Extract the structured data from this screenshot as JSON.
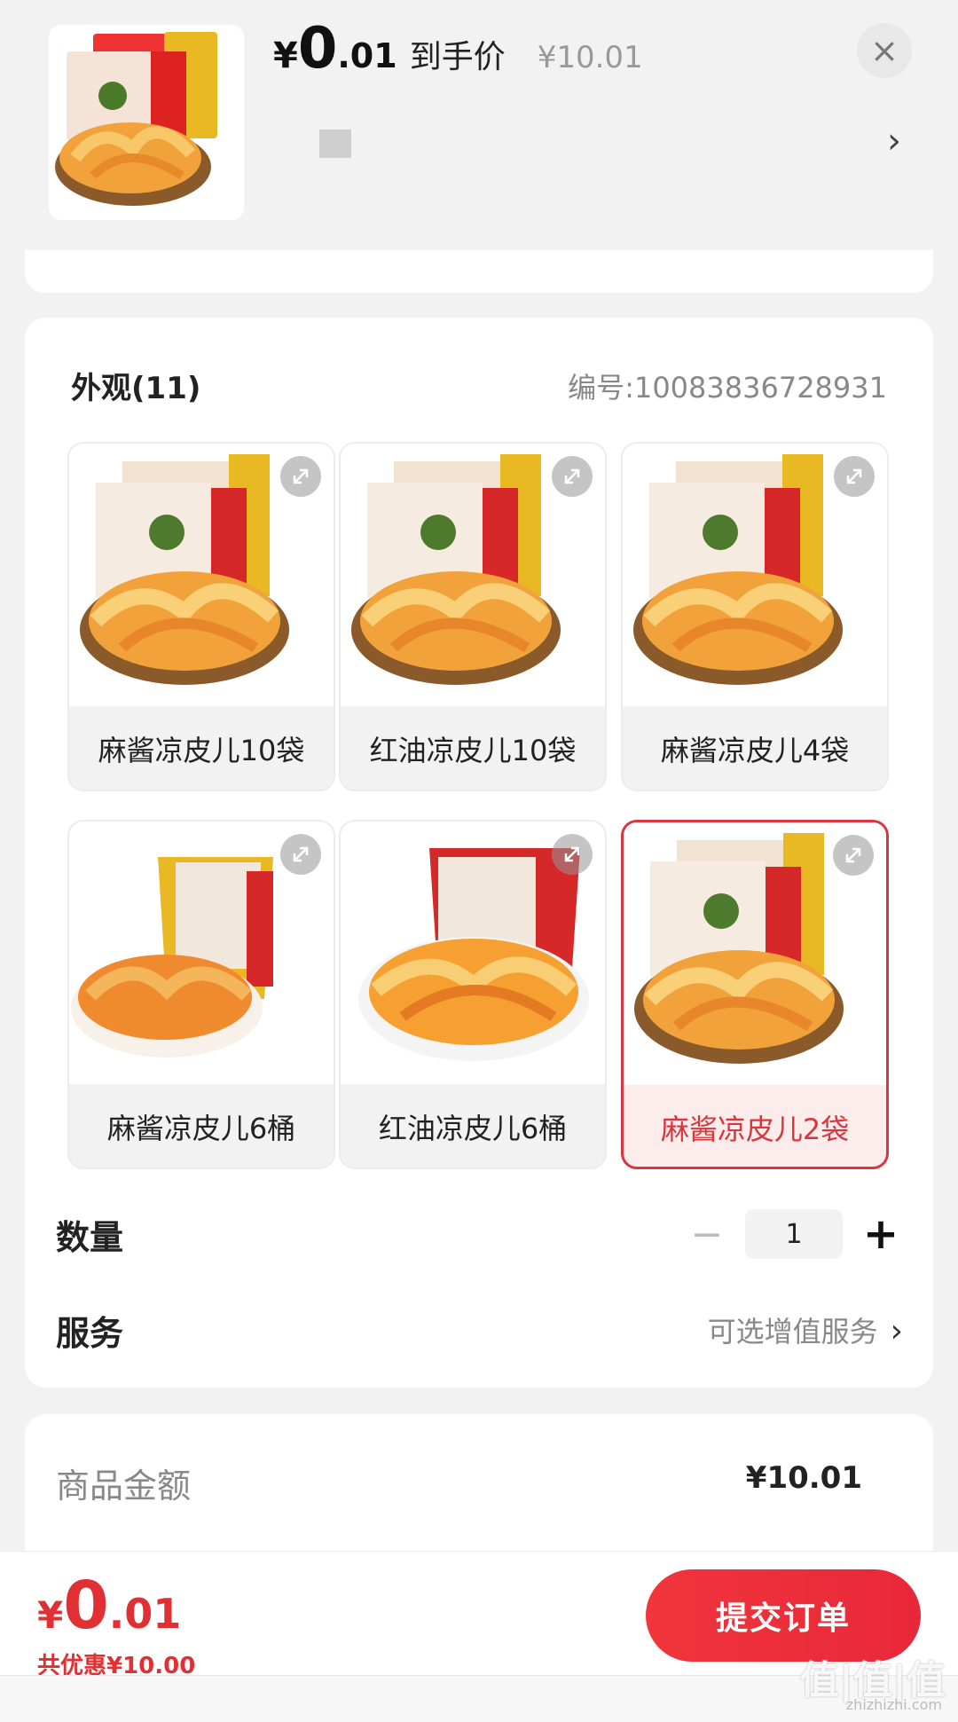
{
  "header": {
    "price_yen": "¥",
    "price_int": "0",
    "price_dec": ".01",
    "price_tag": "到手价",
    "original_price": "¥10.01",
    "close_icon": "×",
    "chevron": "›"
  },
  "appearance": {
    "title": "外观(11)",
    "code": "编号:10083836728931",
    "options": [
      {
        "label": "麻酱凉皮儿10袋",
        "image": "bag-pack",
        "selected": false
      },
      {
        "label": "红油凉皮儿10袋",
        "image": "bag-pack",
        "selected": false
      },
      {
        "label": "麻酱凉皮儿4袋",
        "image": "bag-pack",
        "selected": false
      },
      {
        "label": "麻酱凉皮儿6桶",
        "image": "bucket-pack",
        "selected": false
      },
      {
        "label": "红油凉皮儿6桶",
        "image": "bucket-pack",
        "selected": false
      },
      {
        "label": "麻酱凉皮儿2袋",
        "image": "bag-pack",
        "selected": true
      }
    ]
  },
  "quantity": {
    "label": "数量",
    "value": "1",
    "minus": "−",
    "plus": "+"
  },
  "service": {
    "label": "服务",
    "value": "可选增值服务",
    "chevron": "›"
  },
  "price_detail": {
    "goods_label": "商品金额",
    "goods_value": "¥10.01"
  },
  "bottom_bar": {
    "total_yen": "¥",
    "total_int": "0",
    "total_dec": ".01",
    "discount": "共优惠¥10.00",
    "submit": "提交订单"
  },
  "watermark": {
    "text": "值|值|值",
    "sub": "zhizhizhi.com"
  },
  "colors": {
    "accent_red": "#e03033",
    "selected_border": "#d9363e",
    "background": "#f2f2f2"
  }
}
